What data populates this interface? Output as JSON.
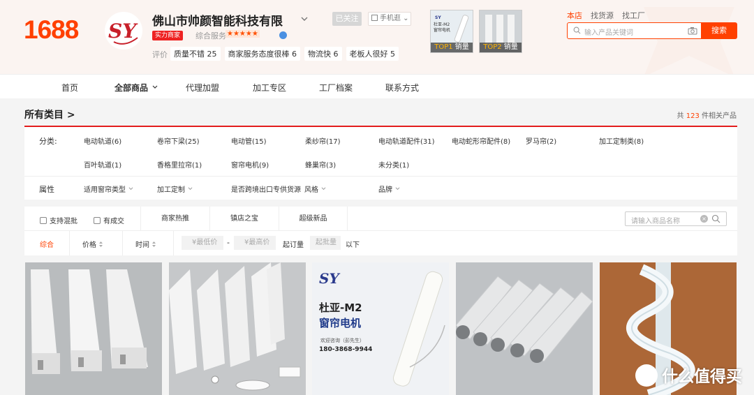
{
  "brand": {
    "logo": "1688",
    "accent": "#ff4000"
  },
  "shop": {
    "name": "佛山市帅颜智能科技有限",
    "logo_letters": "SY",
    "followed": "已关注",
    "mobile": "手机逛",
    "badge": "实力商家",
    "service_label": "综合服务",
    "stars": "★★★★★",
    "eval_label": "评价",
    "eval_chips": [
      "质量不错 25",
      "商家服务态度很棒 6",
      "物流快 6",
      "老板人很好 5"
    ]
  },
  "top_products": [
    {
      "rank": "TOP1",
      "label": "销量",
      "caption_cn": "杜亚-M2",
      "caption_sub": "窗帘电机"
    },
    {
      "rank": "TOP2",
      "label": "销量"
    }
  ],
  "search": {
    "tabs": [
      "本店",
      "找货源",
      "找工厂"
    ],
    "placeholder": "输入产品关键词",
    "button": "搜索"
  },
  "nav": [
    "首页",
    "全部商品",
    "代理加盟",
    "加工专区",
    "工厂档案",
    "联系方式"
  ],
  "category": {
    "title": "所有类目 >",
    "count_prefix": "共",
    "count": "123",
    "count_suffix": "件相关产品"
  },
  "filters": {
    "category_label": "分类:",
    "categories": [
      "电动轨道(6)",
      "卷帘下梁(25)",
      "电动管(15)",
      "柔纱帘(17)",
      "电动轨道配件(31)",
      "电动蛇形帘配件(8)",
      "罗马帘(2)",
      "加工定制类(8)",
      "百叶轨道(1)",
      "香格里拉帘(1)",
      "窗帘电机(9)",
      "蜂巢帘(3)",
      "未分类(1)"
    ],
    "attr_label": "属性",
    "attrs": [
      "适用窗帘类型",
      "加工定制",
      "是否跨境出口专供货源",
      "风格",
      "品牌"
    ]
  },
  "toolbar": {
    "checkboxes": [
      "支持混批",
      "有成交"
    ],
    "tabs": [
      "商家热推",
      "镇店之宝",
      "超级新品"
    ],
    "search_placeholder": "请输入商品名称",
    "sorts": [
      "综合",
      "价格",
      "时间"
    ],
    "min_price": "¥最低价",
    "max_price": "¥最高价",
    "dash": "-",
    "moq_label": "起订量",
    "moq_placeholder": "起批量",
    "below": "以下"
  },
  "product_cards": [
    {
      "name": "white-track-profiles"
    },
    {
      "name": "track-profiles-with-accessories"
    },
    {
      "name": "curtain-motor-ad",
      "logo": "SY",
      "title": "杜亚-M2",
      "subtitle": "窗帘电机",
      "contact": "欢迎咨询（彭先生）",
      "phone": "180-3868-9944"
    },
    {
      "name": "aluminum-tubes"
    },
    {
      "name": "snake-curtain-wave"
    }
  ],
  "watermark": "什么值得买"
}
